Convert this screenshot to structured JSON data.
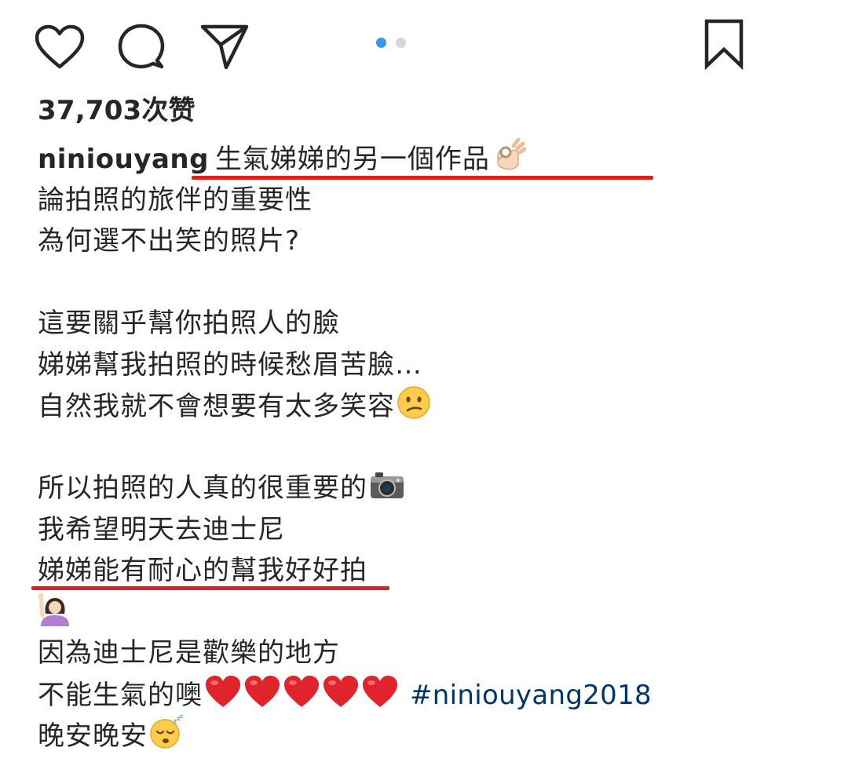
{
  "actions": {
    "like_icon": "heart-outline-icon",
    "comment_icon": "speech-bubble-icon",
    "share_icon": "paper-plane-icon",
    "save_icon": "bookmark-outline-icon"
  },
  "carousel": {
    "total": 2,
    "active": 1,
    "active_color": "#3897f0",
    "inactive_color": "#d6d6d6"
  },
  "likes_text": "37,703次赞",
  "caption": {
    "username": "niniouyang",
    "line1": "生氣娣娣的另一個作品",
    "line1_emoji": "ok-hand-emoji",
    "line2": "論拍照的旅伴的重要性",
    "line3": "為何選不出笑的照片?",
    "line4": "這要關乎幫你拍照人的臉",
    "line5": "娣娣幫我拍照的時候愁眉苦臉…",
    "line6": "自然我就不會想要有太多笑容",
    "line6_emoji": "confused-face-emoji",
    "line7": "所以拍照的人真的很重要的",
    "line7_emoji": "camera-emoji",
    "line8": "我希望明天去迪士尼",
    "line9": "娣娣能有耐心的幫我好好拍",
    "line10_emoji": "woman-raising-hand-emoji",
    "line11": "因為迪士尼是歡樂的地方",
    "line12": "不能生氣的噢",
    "line12_emoji": "red-heart-emoji",
    "hashtag": "#niniouyang2018",
    "line13": "晚安晚安",
    "line13_emoji": "sleeping-face-emoji"
  },
  "colors": {
    "text": "#262626",
    "hashtag": "#003569",
    "highlight_underline": "#e51f1f"
  }
}
